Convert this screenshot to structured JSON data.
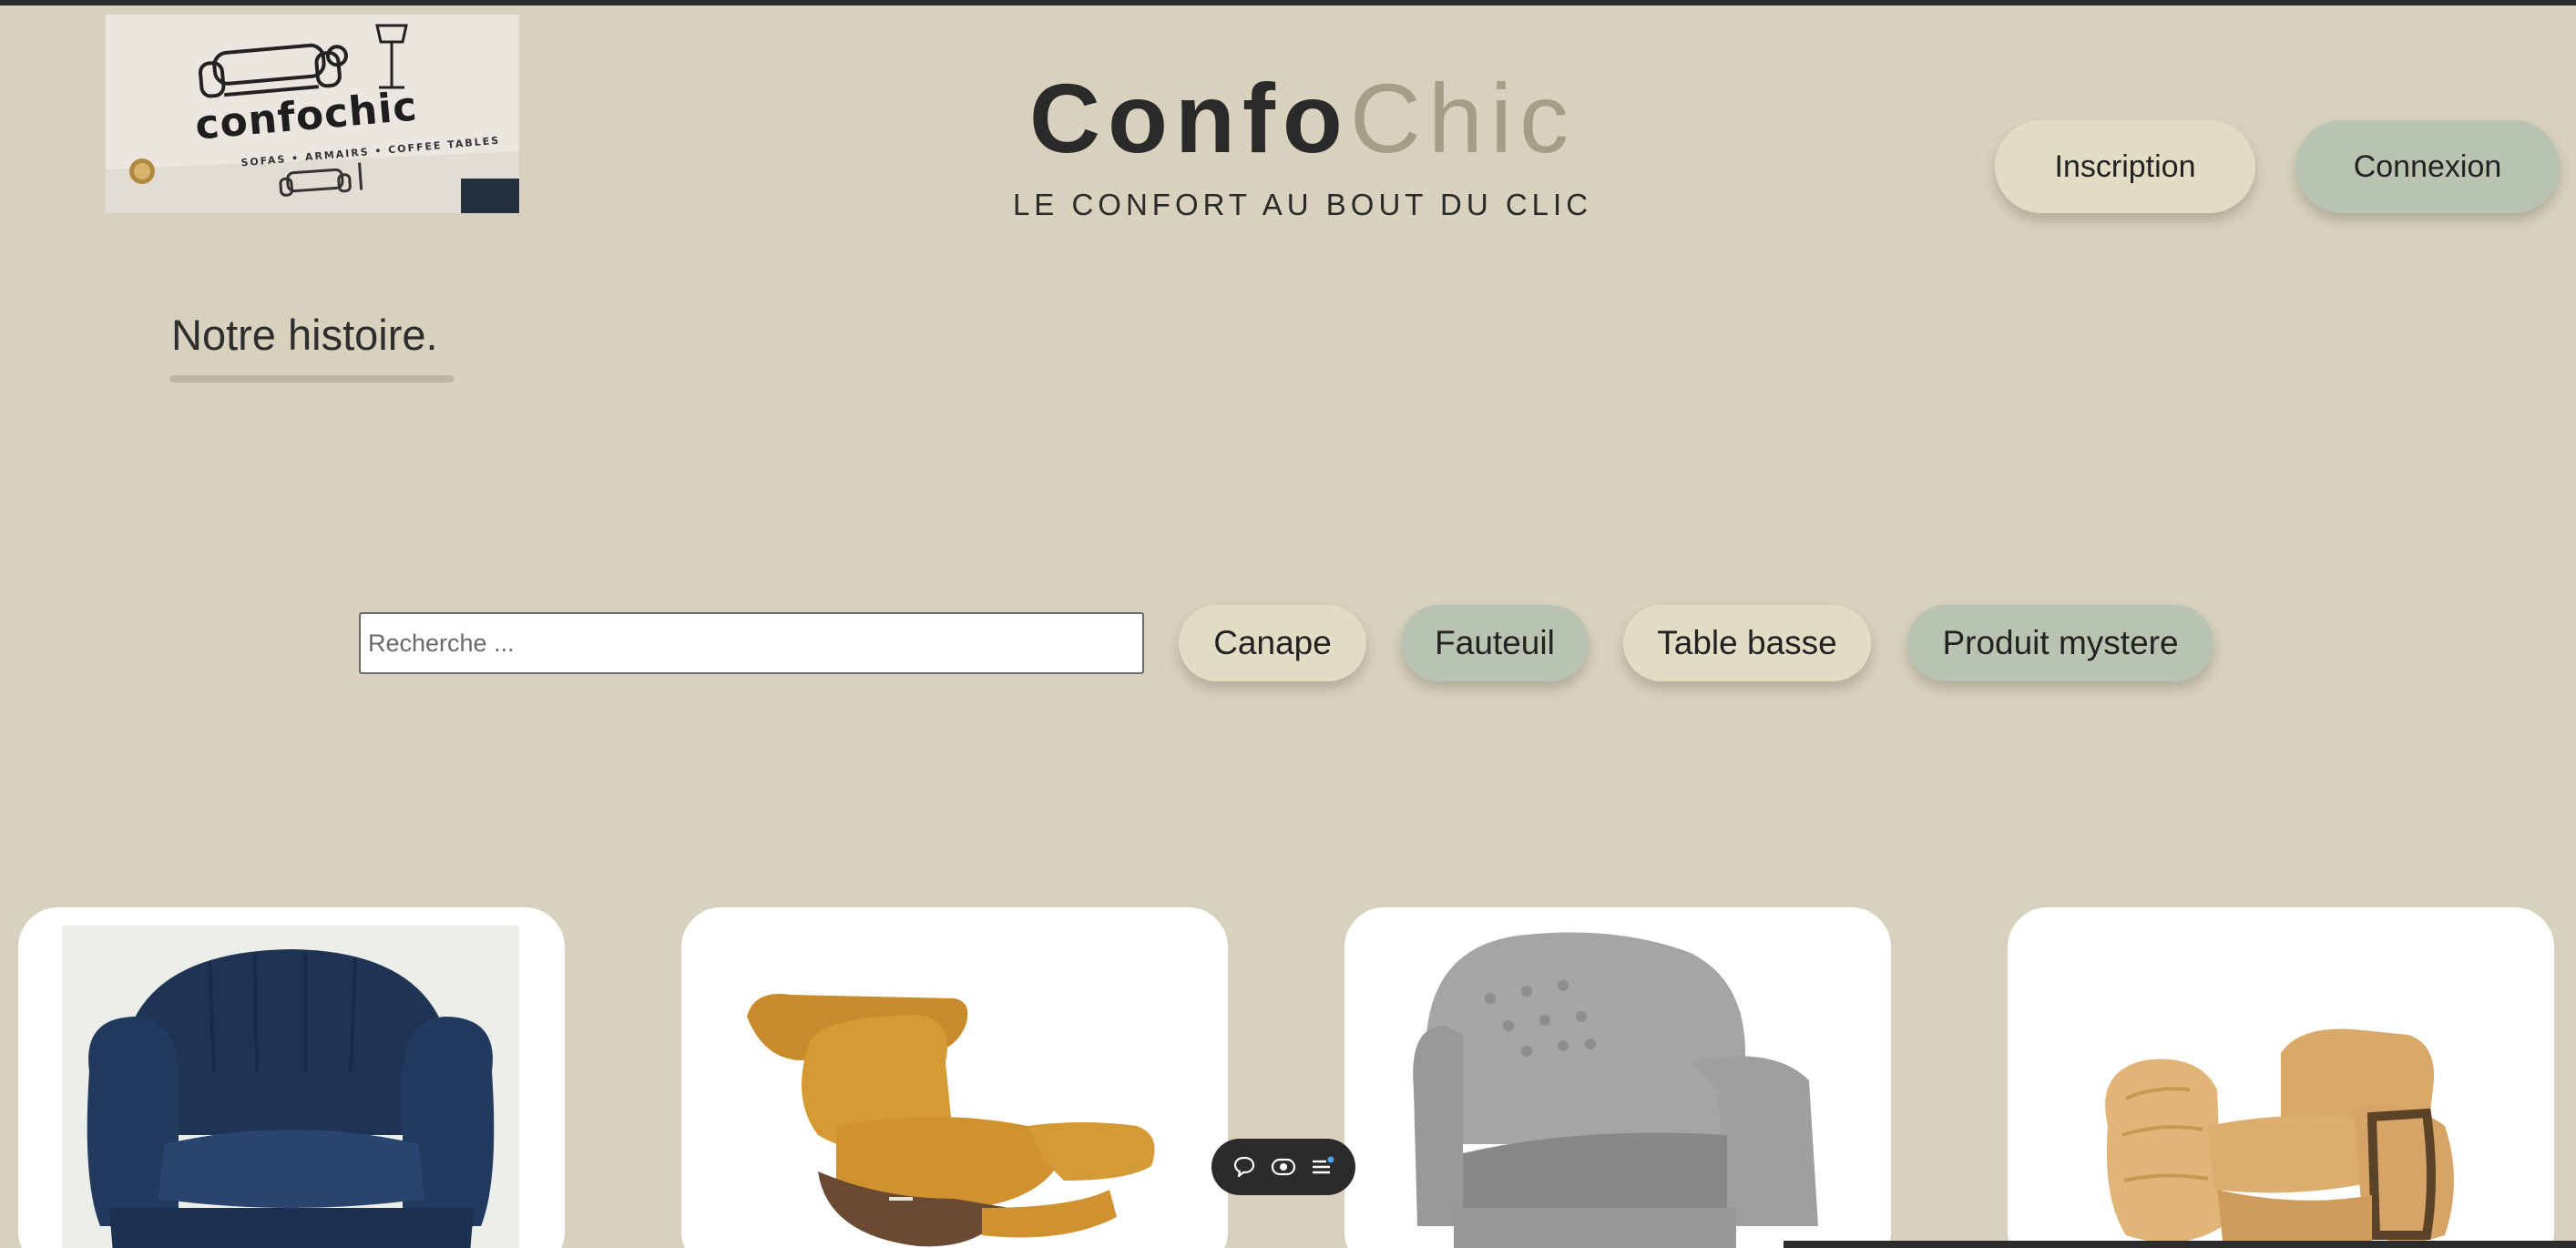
{
  "header": {
    "brand_part1": "Confo",
    "brand_part2": "Chic",
    "subtitle": "LE CONFORT AU BOUT DU CLIC",
    "logo": {
      "wordmark": "confochic",
      "tagline": "SOFAS • ARMAIRS • COFFEE TABLES"
    },
    "buttons": {
      "inscription": "Inscription",
      "connexion": "Connexion"
    }
  },
  "story_link": "Notre histoire.",
  "search": {
    "placeholder": "Recherche ...",
    "value": ""
  },
  "categories": [
    "Canape",
    "Fauteuil",
    "Table basse",
    "Produit mystere"
  ],
  "products": [
    {
      "image": "navy-blue-channel-tufted-armchair"
    },
    {
      "image": "mustard-leather-recliner-chair"
    },
    {
      "image": "grey-button-tufted-armchair"
    },
    {
      "image": "tan-velvet-ruched-armchair"
    }
  ],
  "toolbar": {
    "icons": [
      "speech-bubble-icon",
      "eye-toggle-icon",
      "list-menu-icon"
    ]
  },
  "colors": {
    "page_bg": "#d8d1bd",
    "beige_button": "#e3dcc5",
    "sage_button": "#b8c4b1",
    "brand_dark": "#2a2a2a",
    "brand_light": "#a39e88"
  }
}
